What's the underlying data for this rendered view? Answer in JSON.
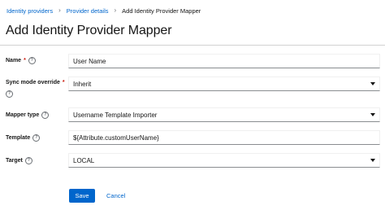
{
  "breadcrumb": {
    "items": [
      "Identity providers",
      "Provider details"
    ],
    "current": "Add Identity Provider Mapper"
  },
  "page": {
    "title": "Add Identity Provider Mapper"
  },
  "form": {
    "name": {
      "label": "Name",
      "value": "User Name"
    },
    "sync_mode": {
      "label": "Sync mode override",
      "value": "Inherit"
    },
    "mapper_type": {
      "label": "Mapper type",
      "value": "Username Template Importer"
    },
    "template": {
      "label": "Template",
      "value": "${Attribute.customUserName}"
    },
    "target": {
      "label": "Target",
      "value": "LOCAL"
    }
  },
  "actions": {
    "save_label": "Save",
    "cancel_label": "Cancel"
  },
  "colors": {
    "primary": "#0066cc",
    "required": "#c9190b",
    "text": "#151515"
  }
}
